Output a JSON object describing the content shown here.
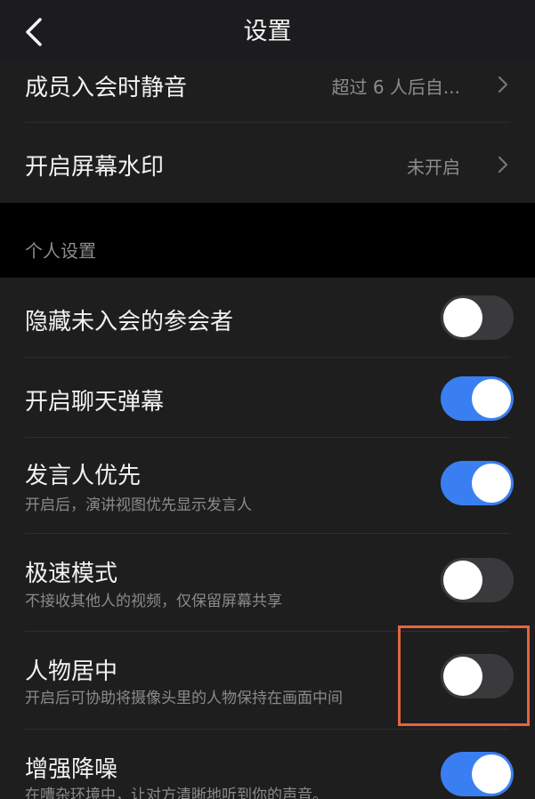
{
  "header": {
    "title": "设置",
    "back_icon": "chevron-left-icon"
  },
  "meeting_settings": [
    {
      "label": "成员入会时静音",
      "value": "超过 6 人后自..."
    },
    {
      "label": "开启屏幕水印",
      "value": "未开启"
    }
  ],
  "personal_section": {
    "title": "个人设置"
  },
  "personal_settings": [
    {
      "label": "隐藏未入会的参会者",
      "subtitle": "",
      "on": false
    },
    {
      "label": "开启聊天弹幕",
      "subtitle": "",
      "on": true
    },
    {
      "label": "发言人优先",
      "subtitle": "开启后，演讲视图优先显示发言人",
      "on": true
    },
    {
      "label": "极速模式",
      "subtitle": "不接收其他人的视频，仅保留屏幕共享",
      "on": false
    },
    {
      "label": "人物居中",
      "subtitle": "开启后可协助将摄像头里的人物保持在画面中间",
      "on": false
    },
    {
      "label": "增强降噪",
      "subtitle": "在嘈杂环境中，让对方清晰地听到你的声音。",
      "on": true
    }
  ],
  "colors": {
    "background": "#1e1e1e",
    "section_background": "#000000",
    "toggle_on": "#3a7ff1",
    "toggle_off": "#3a3a3c",
    "highlight": "#e5643f"
  }
}
